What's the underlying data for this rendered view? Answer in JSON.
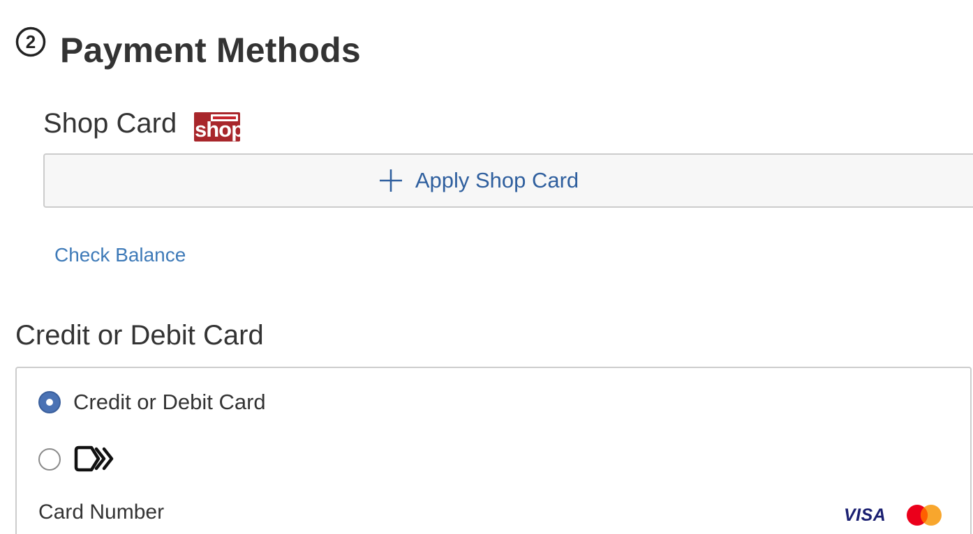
{
  "header": {
    "step_number": "2",
    "title": "Payment Methods"
  },
  "shop_card": {
    "title": "Shop Card",
    "logo_text": "shop",
    "apply_label": "Apply Shop Card",
    "check_balance_label": "Check Balance"
  },
  "credit_section": {
    "title": "Credit or Debit Card",
    "options": [
      {
        "label": "Credit or Debit Card",
        "selected": true
      },
      {
        "label": "",
        "icon": "link-pay-icon",
        "selected": false
      }
    ],
    "card_number_label": "Card Number",
    "brand_logos": [
      "visa-logo",
      "mastercard-logo"
    ],
    "visa_text": "VISA"
  },
  "colors": {
    "link": "#3e7ab8",
    "apply_text": "#2f5f9e",
    "radio_selected": "#4a72b4",
    "shop_logo_bg": "#a8262b",
    "visa_blue": "#1a1f71",
    "mc_red": "#eb001b",
    "mc_orange": "#f79e1b"
  }
}
